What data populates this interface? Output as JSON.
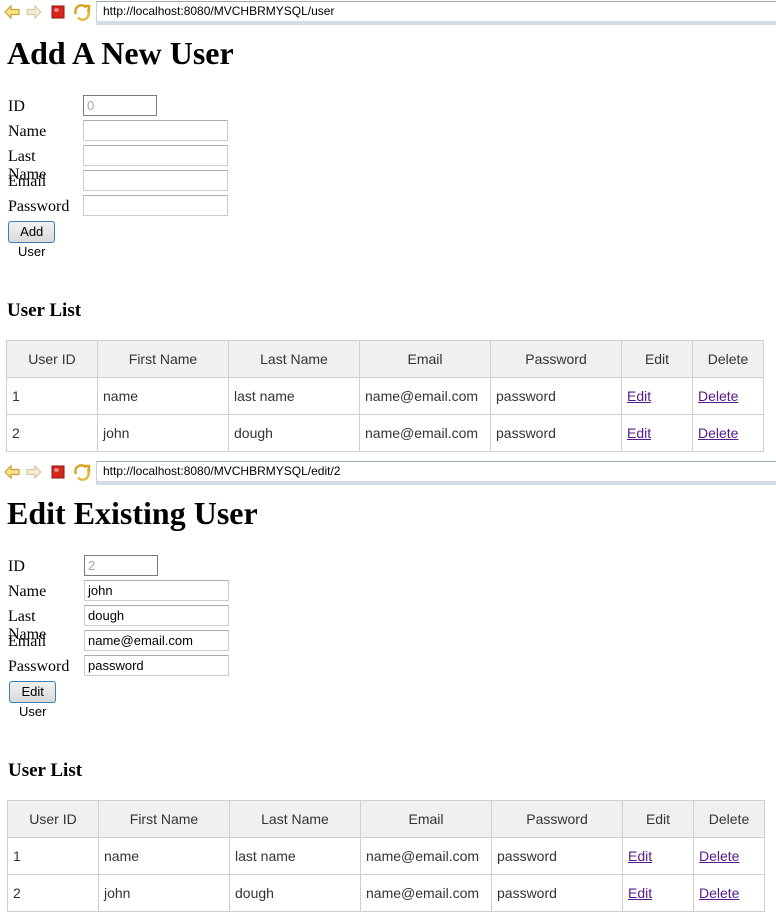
{
  "panels": [
    {
      "url": "http://localhost:8080/MVCHBRMYSQL/user",
      "title": "Add A New User",
      "form": {
        "labels": {
          "id": "ID",
          "name": "Name",
          "last_name": "Last Name",
          "email": "Email",
          "password": "Password"
        },
        "values": {
          "id": "0",
          "name": "",
          "last_name": "",
          "email": "",
          "password": ""
        },
        "submit_label": "Add User"
      },
      "list_title": "User List"
    },
    {
      "url": "http://localhost:8080/MVCHBRMYSQL/edit/2",
      "title": "Edit Existing User",
      "form": {
        "labels": {
          "id": "ID",
          "name": "Name",
          "last_name": "Last Name",
          "email": "Email",
          "password": "Password"
        },
        "values": {
          "id": "2",
          "name": "john",
          "last_name": "dough",
          "email": "name@email.com",
          "password": "password"
        },
        "submit_label": "Edit User"
      },
      "list_title": "User List"
    }
  ],
  "table": {
    "headers": [
      "User ID",
      "First Name",
      "Last Name",
      "Email",
      "Password",
      "Edit",
      "Delete"
    ],
    "rows": [
      {
        "id": "1",
        "first": "name",
        "last": "last name",
        "email": "name@email.com",
        "password": "password",
        "edit": "Edit",
        "delete": "Delete"
      },
      {
        "id": "2",
        "first": "john",
        "last": "dough",
        "email": "name@email.com",
        "password": "password",
        "edit": "Edit",
        "delete": "Delete"
      }
    ]
  },
  "toolbar_icons": [
    "back-arrow-icon",
    "forward-arrow-icon",
    "stop-icon",
    "refresh-icon"
  ],
  "colors": {
    "link_visited": "#551a8b",
    "stop_red": "#d9261c",
    "button_border": "#3c7fb1"
  }
}
